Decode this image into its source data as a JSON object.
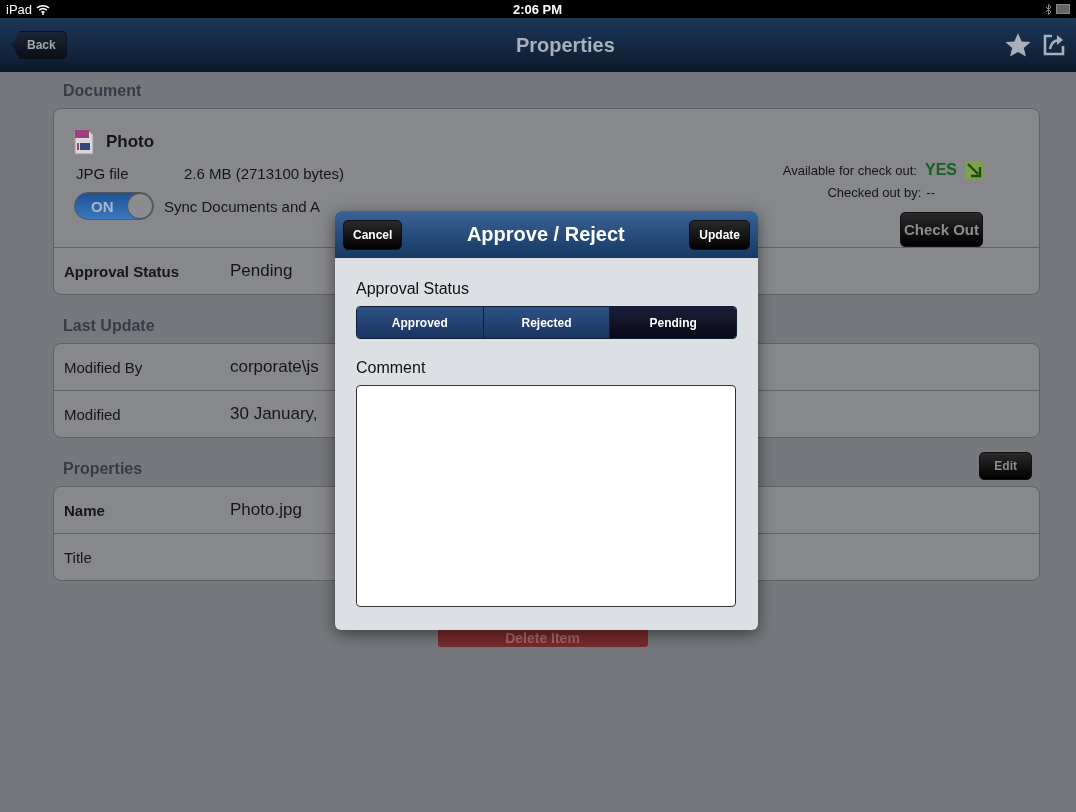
{
  "status_bar": {
    "device": "iPad",
    "time": "2:06 PM"
  },
  "nav_bar": {
    "back": "Back",
    "title": "Properties"
  },
  "document": {
    "heading": "Document",
    "name": "Photo",
    "type": "JPG file",
    "size": "2.6 MB (2713100 bytes)",
    "sync": {
      "label": "ON",
      "on": true,
      "text": "Sync Documents and A"
    },
    "available_label": "Available for check out:",
    "available_value": "YES",
    "checked_out_label": "Checked out by:",
    "checked_out_value": "--",
    "check_out_button": "Check Out",
    "rows": [
      {
        "label": "Approval Status",
        "value": "Pending"
      }
    ]
  },
  "last_update": {
    "heading": "Last Update",
    "rows": [
      {
        "label": "Modified By",
        "value": "corporate\\js"
      },
      {
        "label": "Modified",
        "value": "30 January,"
      }
    ]
  },
  "properties": {
    "heading": "Properties",
    "edit_button": "Edit",
    "rows": [
      {
        "label": "Name",
        "value": "Photo.jpg"
      },
      {
        "label": "Title",
        "value": ""
      }
    ]
  },
  "delete_button": "Delete Item",
  "dialog": {
    "title": "Approve / Reject",
    "cancel": "Cancel",
    "update": "Update",
    "status_label": "Approval Status",
    "segments": [
      {
        "label": "Approved",
        "selected": false
      },
      {
        "label": "Rejected",
        "selected": false
      },
      {
        "label": "Pending",
        "selected": true
      }
    ],
    "comment_label": "Comment"
  }
}
